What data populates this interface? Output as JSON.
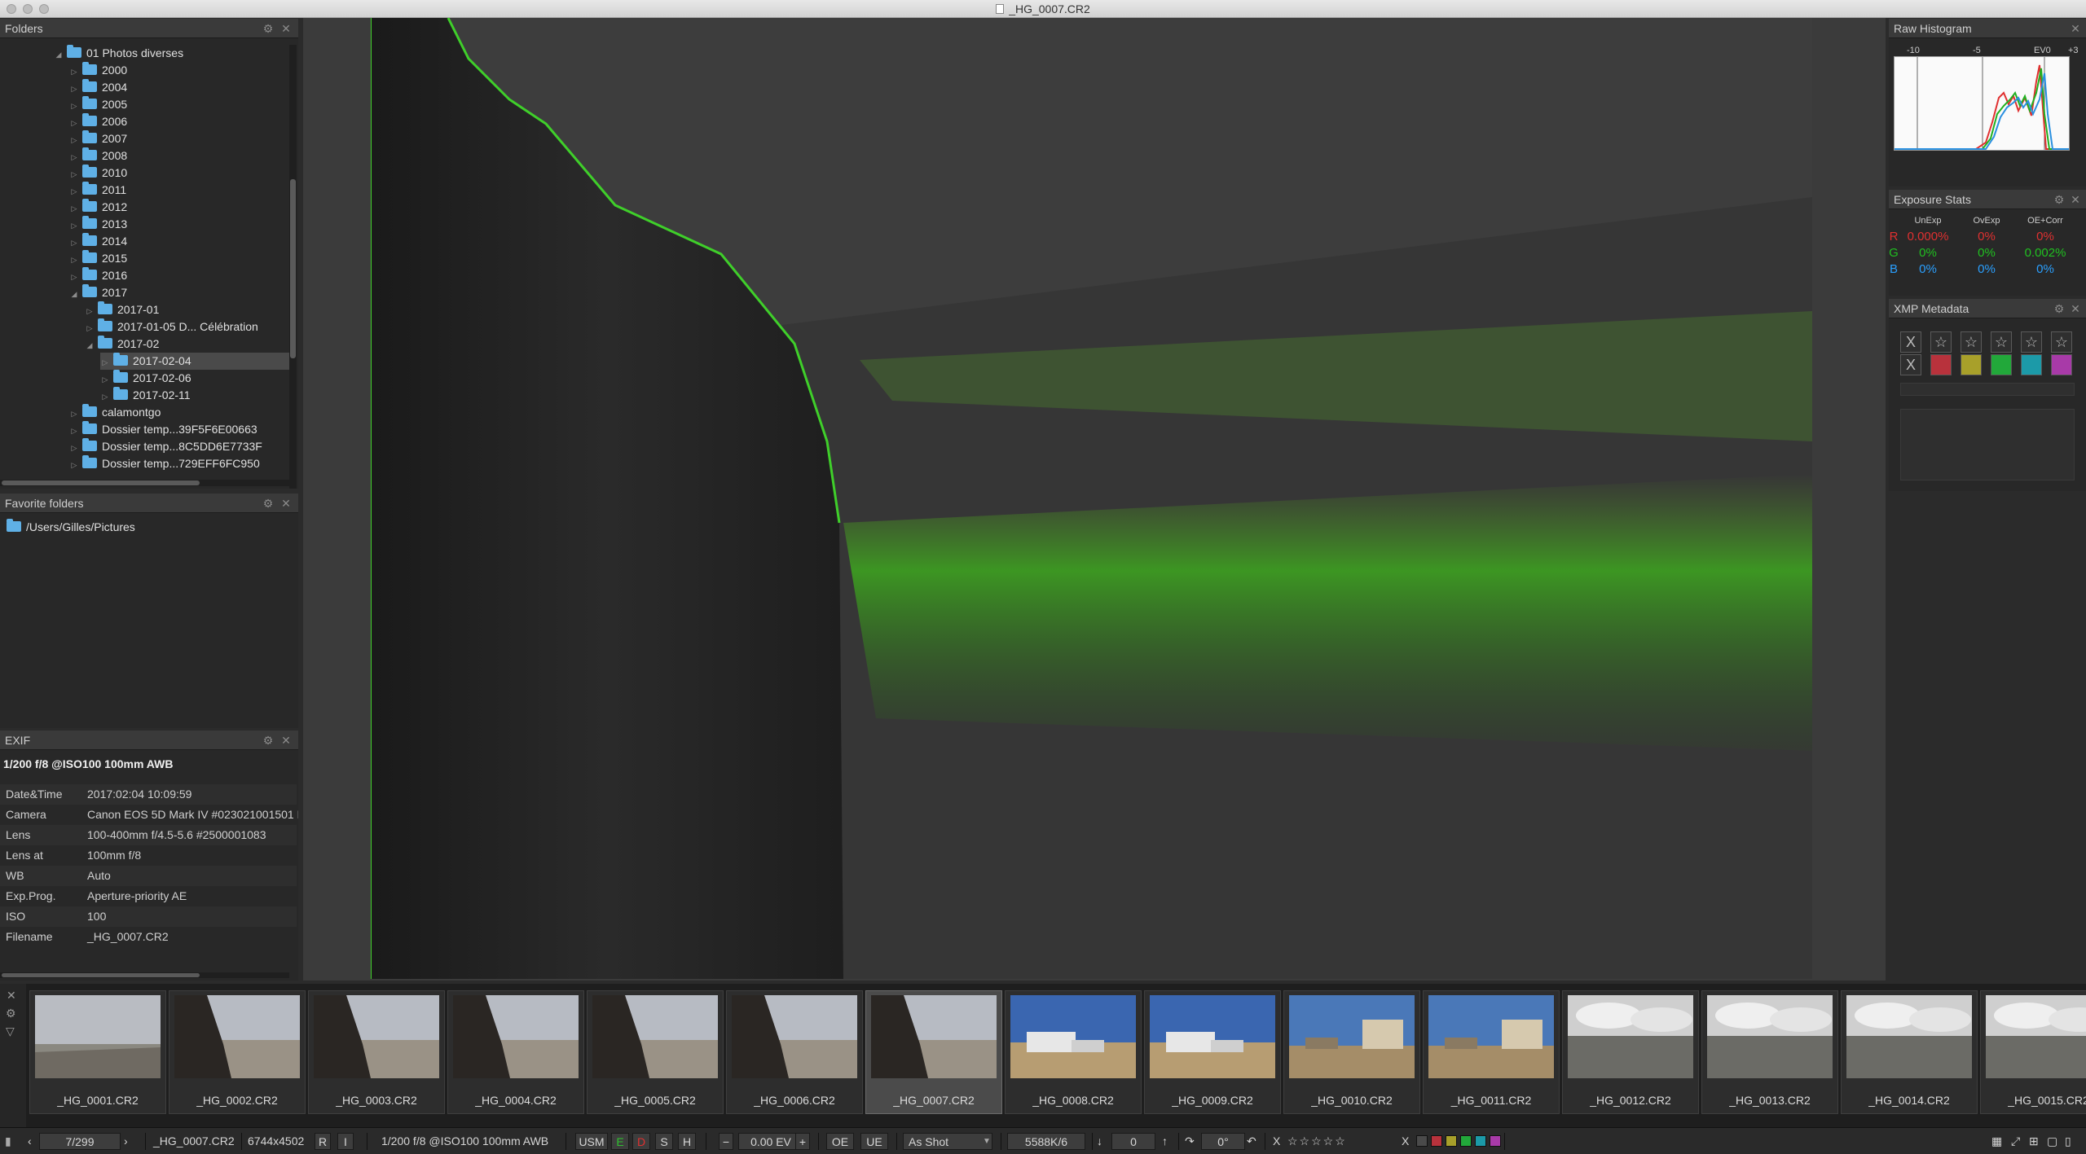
{
  "window": {
    "title": "_HG_0007.CR2"
  },
  "folders_panel": {
    "title": "Folders",
    "items": [
      {
        "label": "01 Photos diverses",
        "depth": 0,
        "expanded": true
      },
      {
        "label": "2000",
        "depth": 1
      },
      {
        "label": "2004",
        "depth": 1
      },
      {
        "label": "2005",
        "depth": 1
      },
      {
        "label": "2006",
        "depth": 1
      },
      {
        "label": "2007",
        "depth": 1
      },
      {
        "label": "2008",
        "depth": 1
      },
      {
        "label": "2010",
        "depth": 1
      },
      {
        "label": "2011",
        "depth": 1
      },
      {
        "label": "2012",
        "depth": 1
      },
      {
        "label": "2013",
        "depth": 1
      },
      {
        "label": "2014",
        "depth": 1
      },
      {
        "label": "2015",
        "depth": 1
      },
      {
        "label": "2016",
        "depth": 1
      },
      {
        "label": "2017",
        "depth": 1,
        "expanded": true
      },
      {
        "label": "2017-01",
        "depth": 2
      },
      {
        "label": "2017-01-05 D... Célébration",
        "depth": 2
      },
      {
        "label": "2017-02",
        "depth": 2,
        "expanded": true
      },
      {
        "label": "2017-02-04",
        "depth": 3,
        "selected": true
      },
      {
        "label": "2017-02-06",
        "depth": 3
      },
      {
        "label": "2017-02-11",
        "depth": 3
      },
      {
        "label": "calamontgo",
        "depth": 1
      },
      {
        "label": "Dossier temp...39F5F6E00663",
        "depth": 1
      },
      {
        "label": "Dossier temp...8C5DD6E7733F",
        "depth": 1
      },
      {
        "label": "Dossier temp...729EFF6FC950",
        "depth": 1
      }
    ]
  },
  "favorites_panel": {
    "title": "Favorite folders",
    "items": [
      "/Users/Gilles/Pictures"
    ]
  },
  "exif_panel": {
    "title": "EXIF",
    "summary": "1/200 f/8 @ISO100 100mm AWB",
    "rows": [
      {
        "key": "Date&Time",
        "value": "2017:02:04 10:09:59"
      },
      {
        "key": "Camera",
        "value": "Canon EOS 5D Mark IV #023021001501 F"
      },
      {
        "key": "Lens",
        "value": "100-400mm f/4.5-5.6 #2500001083"
      },
      {
        "key": "Lens at",
        "value": "100mm f/8"
      },
      {
        "key": "WB",
        "value": "Auto"
      },
      {
        "key": "Exp.Prog.",
        "value": "Aperture-priority AE"
      },
      {
        "key": "ISO",
        "value": "100"
      },
      {
        "key": "Filename",
        "value": "_HG_0007.CR2"
      }
    ]
  },
  "histogram_panel": {
    "title": "Raw Histogram",
    "scale_labels": [
      "-10",
      "-5",
      "EV0",
      "+3"
    ]
  },
  "exposure_stats": {
    "title": "Exposure Stats",
    "headers": [
      "UnExp",
      "OvExp",
      "OE+Corr"
    ],
    "rows": [
      {
        "channel": "R",
        "color": "#e03030",
        "values": [
          "0.000%",
          "0%",
          "0%"
        ]
      },
      {
        "channel": "G",
        "color": "#20c020",
        "values": [
          "0%",
          "0%",
          "0.002%"
        ]
      },
      {
        "channel": "B",
        "color": "#2aa0ff",
        "values": [
          "0%",
          "0%",
          "0%"
        ]
      }
    ]
  },
  "xmp_panel": {
    "title": "XMP Metadata",
    "reject": "X",
    "color_labels": [
      "#b8323c",
      "#a8a02a",
      "#22a83a",
      "#1c9aa8",
      "#a83aa8"
    ]
  },
  "filmstrip": {
    "selected_index": 6,
    "items": [
      {
        "label": "_HG_0001.CR2",
        "scene": "sea"
      },
      {
        "label": "_HG_0002.CR2",
        "scene": "fence"
      },
      {
        "label": "_HG_0003.CR2",
        "scene": "fence"
      },
      {
        "label": "_HG_0004.CR2",
        "scene": "fence"
      },
      {
        "label": "_HG_0005.CR2",
        "scene": "fence"
      },
      {
        "label": "_HG_0006.CR2",
        "scene": "fence"
      },
      {
        "label": "_HG_0007.CR2",
        "scene": "fence"
      },
      {
        "label": "_HG_0008.CR2",
        "scene": "wreck"
      },
      {
        "label": "_HG_0009.CR2",
        "scene": "wreck"
      },
      {
        "label": "_HG_0010.CR2",
        "scene": "house"
      },
      {
        "label": "_HG_0011.CR2",
        "scene": "house"
      },
      {
        "label": "_HG_0012.CR2",
        "scene": "cloud"
      },
      {
        "label": "_HG_0013.CR2",
        "scene": "cloud"
      },
      {
        "label": "_HG_0014.CR2",
        "scene": "cloud"
      },
      {
        "label": "_HG_0015.CR2",
        "scene": "cloud"
      }
    ]
  },
  "toolbar": {
    "position": "7/299",
    "filename": "_HG_0007.CR2",
    "dimensions": "6744x4502",
    "r_label": "R",
    "i_label": "I",
    "shot_info": "1/200 f/8 @ISO100 100mm AWB",
    "usm": "USM",
    "e_label": "E",
    "d_label": "D",
    "s_label": "S",
    "h_label": "H",
    "minus": "−",
    "ev": "0.00 EV",
    "plus": "+",
    "oe": "OE",
    "ue": "UE",
    "wb_mode": "As Shot",
    "temperature": "5588K/6",
    "tint": "0",
    "rotation": "0°",
    "reject": "X",
    "rating_stars": 0,
    "label_colors": [
      "#4a4a4a",
      "#b8323c",
      "#a8a02a",
      "#22a83a",
      "#1c9aa8",
      "#a83aa8"
    ],
    "x_label": "X"
  }
}
